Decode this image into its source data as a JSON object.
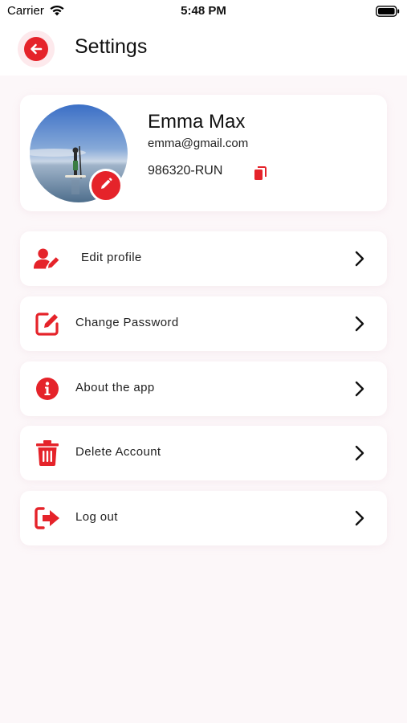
{
  "status_bar": {
    "carrier": "Carrier",
    "time": "5:48 PM"
  },
  "header": {
    "title": "Settings",
    "back_icon": "arrow-left-icon"
  },
  "profile": {
    "name": "Emma Max",
    "email": "emma@gmail.com",
    "id": "986320-RUN",
    "edit_icon": "pencil-icon",
    "copy_icon": "copy-icon"
  },
  "menu": {
    "items": [
      {
        "label": "Edit profile",
        "icon": "user-edit-icon"
      },
      {
        "label": "Change Password",
        "icon": "pen-square-icon"
      },
      {
        "label": "About the app",
        "icon": "info-circle-icon"
      },
      {
        "label": "Delete Account",
        "icon": "trash-icon"
      },
      {
        "label": "Log out",
        "icon": "sign-out-icon"
      }
    ]
  },
  "colors": {
    "accent": "#e5232a",
    "background": "#fcf7f9",
    "card": "#ffffff"
  }
}
